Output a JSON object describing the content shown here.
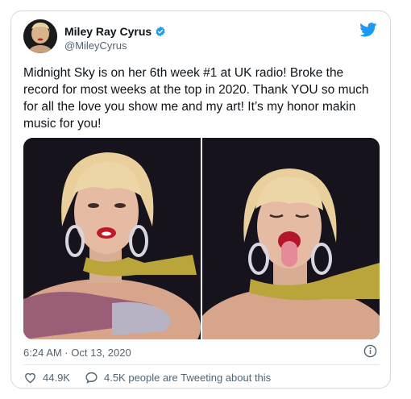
{
  "author": {
    "name": "Miley Ray Cyrus",
    "handle": "@MileyCyrus"
  },
  "tweet": {
    "text": "Midnight Sky is on her 6th week #1 at UK radio! Broke the record for most weeks at the top in 2020. Thank YOU so much for all the love you show me and my art! It’s my honor makin music for you!",
    "timestamp": "6:24 AM · Oct 13, 2020"
  },
  "actions": {
    "likes": "44.9K",
    "conversation": "4.5K people are Tweeting about this"
  },
  "icons": {
    "brand": "twitter-bird-icon",
    "verified": "verified-badge-icon",
    "info": "info-icon",
    "like": "heart-icon",
    "reply": "speech-bubble-icon"
  },
  "colors": {
    "twitter_blue": "#1d9bf0",
    "text_primary": "#0f1419",
    "text_secondary": "#536471",
    "border": "#cfd9de"
  }
}
